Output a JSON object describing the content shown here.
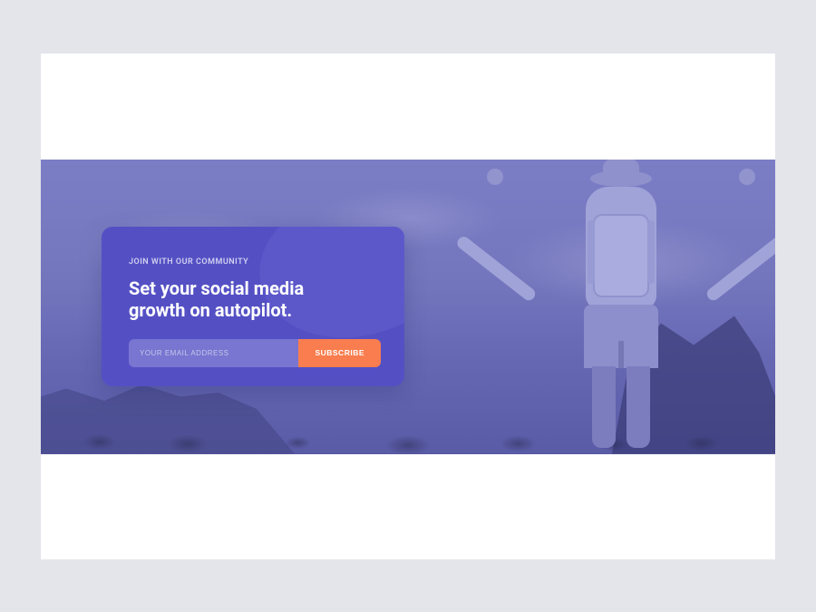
{
  "card": {
    "eyebrow": "JOIN WITH OUR COMMUNITY",
    "headline_line1": "Set your social media",
    "headline_line2": "growth on autopilot.",
    "email_placeholder": "YOUR EMAIL ADDRESS",
    "subscribe_label": "SUBSCRIBE"
  },
  "colors": {
    "card_bg": "#5450c4",
    "accent": "#f97d4e",
    "page_bg": "#e3e5ea"
  }
}
